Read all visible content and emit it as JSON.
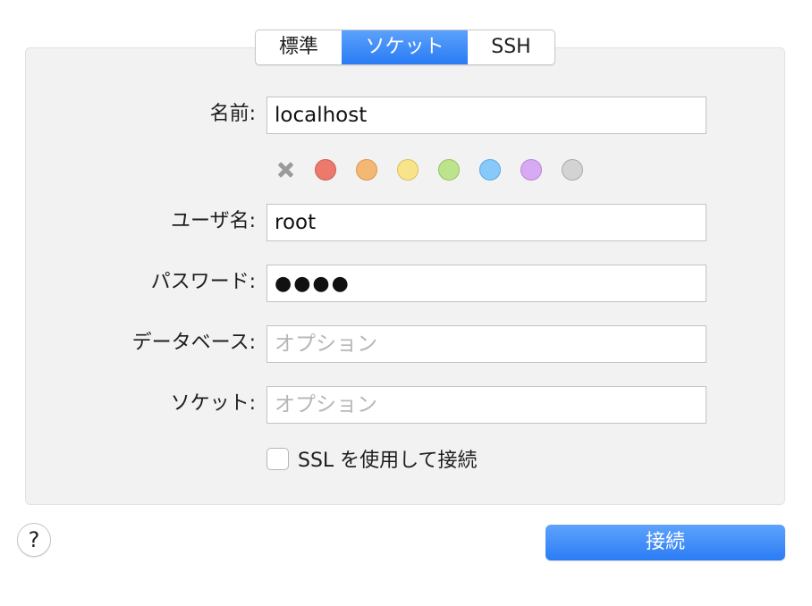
{
  "tabs": {
    "standard": "標準",
    "socket": "ソケット",
    "ssh": "SSH",
    "active": "socket"
  },
  "form": {
    "name_label": "名前:",
    "name_value": "localhost",
    "username_label": "ユーザ名:",
    "username_value": "root",
    "password_label": "パスワード:",
    "password_value": "●●●●",
    "database_label": "データベース:",
    "database_placeholder": "オプション",
    "socket_label": "ソケット:",
    "socket_placeholder": "オプション",
    "ssl_label": "SSL を使用して接続",
    "ssl_checked": false
  },
  "color_tags": {
    "clear_icon": "x-icon",
    "colors": [
      {
        "name": "red",
        "fill": "#ec7a6c",
        "border": "#cf5d4f"
      },
      {
        "name": "orange",
        "fill": "#f5b774",
        "border": "#d9964f"
      },
      {
        "name": "yellow",
        "fill": "#f7e48b",
        "border": "#d8c160"
      },
      {
        "name": "green",
        "fill": "#bde48c",
        "border": "#96c362"
      },
      {
        "name": "blue",
        "fill": "#88c9fb",
        "border": "#5ea8e0"
      },
      {
        "name": "purple",
        "fill": "#d8aaf3",
        "border": "#b884d6"
      },
      {
        "name": "gray",
        "fill": "#d3d3d3",
        "border": "#a9a9a9"
      }
    ]
  },
  "footer": {
    "help_label": "?",
    "connect_label": "接続"
  },
  "accent_color": "#2a7cf5"
}
